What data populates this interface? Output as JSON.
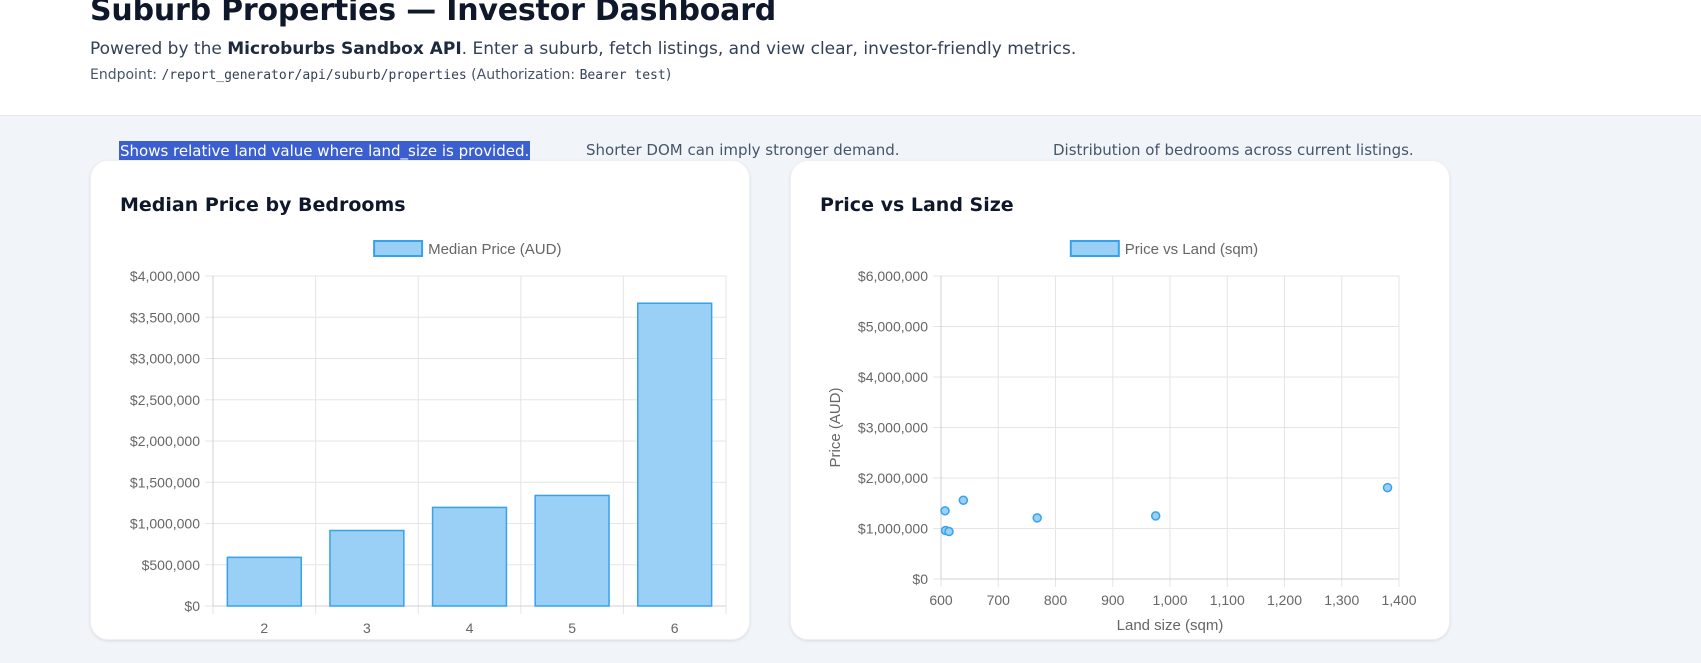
{
  "header": {
    "title": "Suburb Properties — Investor Dashboard",
    "subtitle_prefix": "Powered by the ",
    "subtitle_bold": "Microburbs Sandbox API",
    "subtitle_suffix": ". Enter a suburb, fetch listings, and view clear, investor-friendly metrics.",
    "endpoint_label": "Endpoint: ",
    "endpoint_path": "/report_generator/api/suburb/properties",
    "auth_prefix": " (Authorization: ",
    "auth_value": "Bearer test",
    "auth_suffix": ")"
  },
  "notes": [
    "Shows relative land value where land_size is provided.",
    "Shorter DOM can imply stronger demand.",
    "Distribution of bedrooms across current listings."
  ],
  "colors": {
    "bar_fill": "#9ad0f5",
    "bar_stroke": "#36a2eb",
    "grid": "#e5e5e5",
    "selection": "#3b5fcf"
  },
  "chart_data": [
    {
      "type": "bar",
      "title": "Median Price by Bedrooms",
      "legend": "Median Price (AUD)",
      "legend_position": "top",
      "categories": [
        "2",
        "3",
        "4",
        "5",
        "6"
      ],
      "values": [
        590000,
        915000,
        1195000,
        1340000,
        3670000
      ],
      "ylim": [
        0,
        4000000
      ],
      "yticks": [
        0,
        500000,
        1000000,
        1500000,
        2000000,
        2500000,
        3000000,
        3500000,
        4000000
      ],
      "ytick_labels": [
        "$0",
        "$500,000",
        "$1,000,000",
        "$1,500,000",
        "$2,000,000",
        "$2,500,000",
        "$3,000,000",
        "$3,500,000",
        "$4,000,000"
      ],
      "xlabel": "",
      "ylabel": "",
      "grid": true
    },
    {
      "type": "scatter",
      "title": "Price vs Land Size",
      "legend": "Price vs Land (sqm)",
      "legend_position": "top",
      "points": [
        {
          "x": 607,
          "y": 1350000
        },
        {
          "x": 608,
          "y": 960000
        },
        {
          "x": 614,
          "y": 940000
        },
        {
          "x": 639,
          "y": 1560000
        },
        {
          "x": 768,
          "y": 1210000
        },
        {
          "x": 975,
          "y": 1250000
        },
        {
          "x": 1380,
          "y": 1810000
        }
      ],
      "xlim": [
        600,
        1400
      ],
      "ylim": [
        0,
        6000000
      ],
      "xticks": [
        600,
        700,
        800,
        900,
        1000,
        1100,
        1200,
        1300,
        1400
      ],
      "xtick_labels": [
        "600",
        "700",
        "800",
        "900",
        "1,000",
        "1,100",
        "1,200",
        "1,300",
        "1,400"
      ],
      "yticks": [
        0,
        1000000,
        2000000,
        3000000,
        4000000,
        5000000,
        6000000
      ],
      "ytick_labels": [
        "$0",
        "$1,000,000",
        "$2,000,000",
        "$3,000,000",
        "$4,000,000",
        "$5,000,000",
        "$6,000,000"
      ],
      "xlabel": "Land size (sqm)",
      "ylabel": "Price (AUD)",
      "grid": true
    }
  ]
}
